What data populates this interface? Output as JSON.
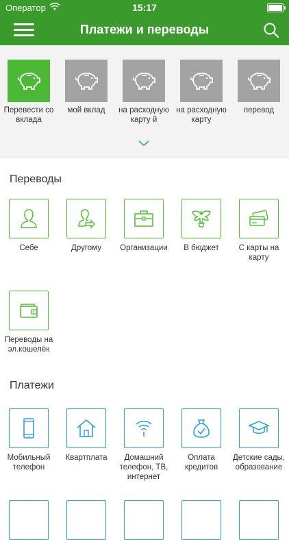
{
  "status": {
    "carrier": "Оператор",
    "time": "15:17"
  },
  "header": {
    "title": "Платежи и переводы"
  },
  "deposits": [
    {
      "label": "Перевести со вклада",
      "active": true
    },
    {
      "label": "мой вклад"
    },
    {
      "label": "на расходную карту й"
    },
    {
      "label": "на расходную карту"
    },
    {
      "label": "перевод"
    }
  ],
  "transfers": {
    "title": "Переводы",
    "items": [
      {
        "label": "Себе",
        "icon": "person-icon"
      },
      {
        "label": "Другому",
        "icon": "person-transfer-icon"
      },
      {
        "label": "Организации",
        "icon": "briefcase-icon"
      },
      {
        "label": "В бюджет",
        "icon": "emblem-icon"
      },
      {
        "label": "С карты на карту",
        "icon": "cards-icon"
      },
      {
        "label": "Переводы на эл.кошелёк",
        "icon": "wallet-icon"
      }
    ]
  },
  "payments": {
    "title": "Платежи",
    "items": [
      {
        "label": "Мобильный телефон",
        "icon": "mobile-phone-icon"
      },
      {
        "label": "Квартплата",
        "icon": "house-icon"
      },
      {
        "label": "Домашний телефон, ТВ, интернет",
        "icon": "wireless-icon"
      },
      {
        "label": "Оплата кредитов",
        "icon": "money-bag-icon"
      },
      {
        "label": "Детские сады, образование",
        "icon": "graduation-cap-icon"
      }
    ]
  },
  "colors": {
    "header": "#3b9a2c",
    "active_tile": "#4cb936",
    "inactive_tile": "#a3a3a3",
    "transfer_border": "#57c03b",
    "payment_border": "#2f9fd9"
  }
}
